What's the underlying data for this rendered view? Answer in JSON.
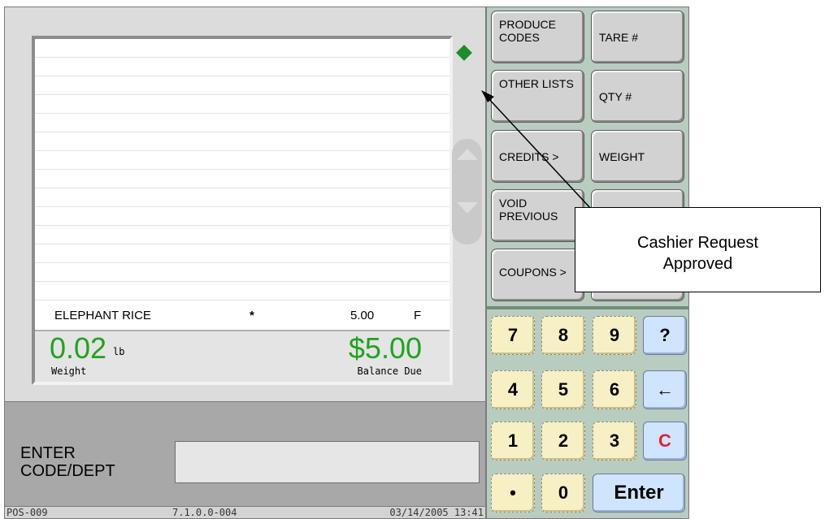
{
  "receipt": {
    "item": {
      "name": "ELEPHANT RICE",
      "marker": "*",
      "price": "5.00",
      "flag": "F"
    },
    "weight": {
      "value": "0.02",
      "unit": "lb",
      "label": "Weight"
    },
    "balance": {
      "value": "$5.00",
      "label": "Balance Due"
    }
  },
  "entry": {
    "label": "ENTER CODE/DEPT",
    "value": ""
  },
  "status_bar": {
    "terminal": "POS-009",
    "version": "7.1.0.0-004",
    "datetime": "03/14/2005 13:41"
  },
  "function_keys": {
    "produce_codes": "PRODUCE CODES",
    "tare": "TARE #",
    "other_lists": "OTHER LISTS",
    "qty": "QTY #",
    "credits": "CREDITS >",
    "weight": "WEIGHT",
    "void_previous": "VOID PREVIOUS",
    "coupons": "COUPONS >"
  },
  "keypad": {
    "k7": "7",
    "k8": "8",
    "k9": "9",
    "help": "?",
    "k4": "4",
    "k5": "5",
    "k6": "6",
    "back": "←",
    "k1": "1",
    "k2": "2",
    "k3": "3",
    "clear": "C",
    "dot": "•",
    "k0": "0",
    "enter": "Enter"
  },
  "callout": {
    "line1": "Cashier Request",
    "line2": "Approved"
  },
  "colors": {
    "amount_green": "#1fa31f",
    "status_diamond": "#1c8c2c",
    "clear_red": "#e0203a",
    "keypad_yellow": "#f7f0c4",
    "keypad_blue": "#cfe4ff",
    "panel_green": "#b8ccc0"
  },
  "icons": {
    "status": "green-diamond-icon",
    "scroll_up": "triangle-up-icon",
    "scroll_down": "triangle-down-icon"
  }
}
